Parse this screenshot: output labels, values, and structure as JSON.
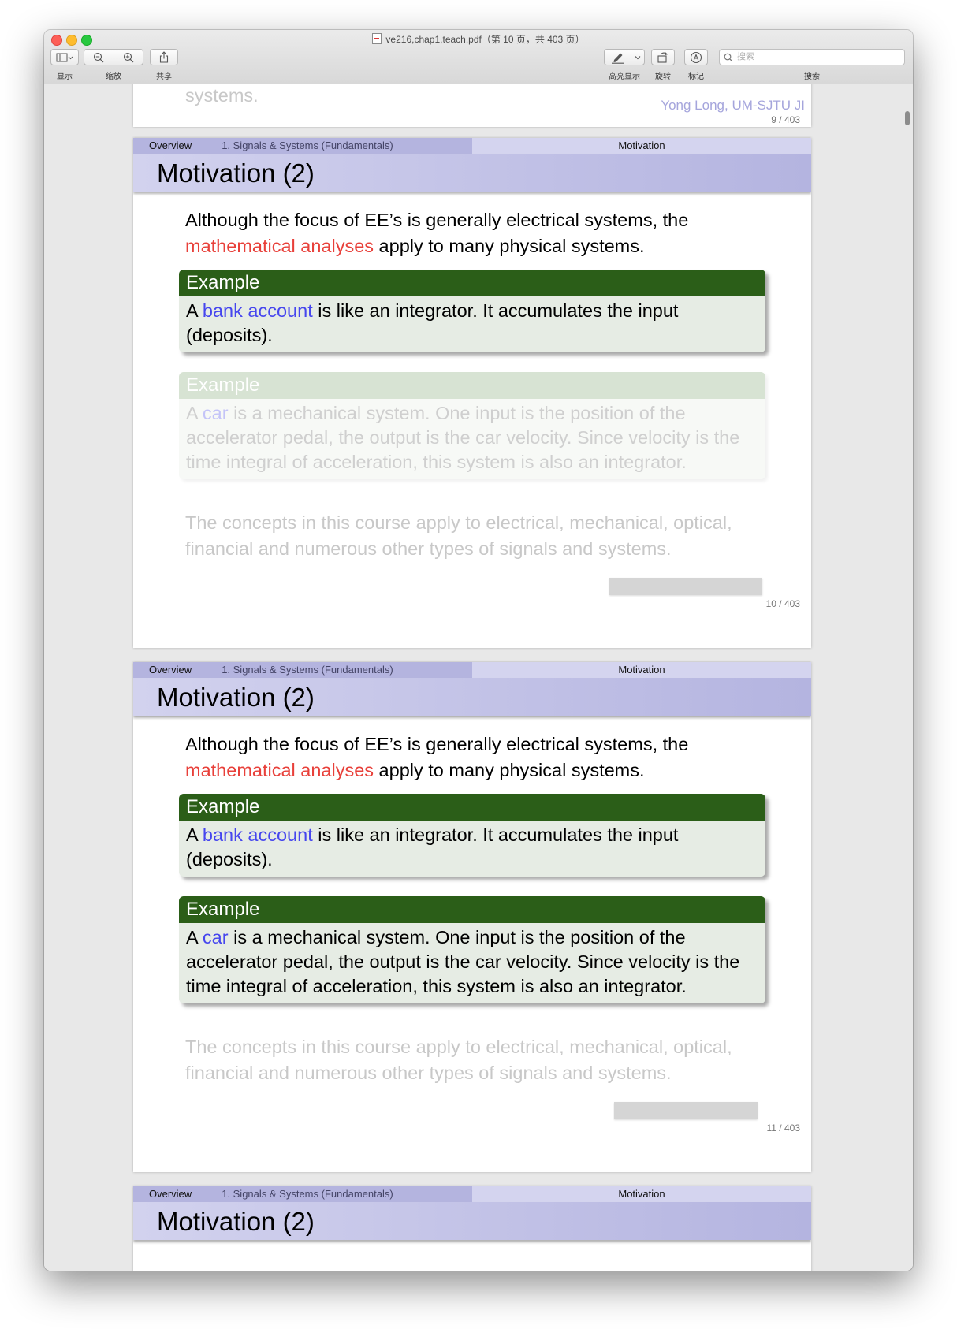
{
  "window": {
    "title": "ve216,chap1,teach.pdf（第 10 页，共 403 页）"
  },
  "toolbar": {
    "display_label": "显示",
    "zoom_label": "缩放",
    "share_label": "共享",
    "highlight_label": "高亮显示",
    "rotate_label": "旋转",
    "markup_label": "标记",
    "search_label": "搜索",
    "search_placeholder": "搜索"
  },
  "pages": {
    "p9": {
      "page_number": "9 / 403",
      "author": "Yong Long, UM-SJTU JI",
      "partial_text": "systems."
    },
    "p10": {
      "nav_section": "Overview",
      "nav_subsection": "1. Signals & Systems (Fundamentals)",
      "nav_right": "Motivation",
      "title": "Motivation (2)",
      "intro_a": "Although the focus of EE’s is generally electrical systems, the ",
      "intro_red": "mathematical analyses",
      "intro_b": " apply to many physical systems.",
      "ex1_title": "Example",
      "ex1_a": "A ",
      "ex1_blue": "bank account",
      "ex1_b": " is like an integrator. It accumulates the input (deposits).",
      "ex2_title": "Example",
      "ex2_a": "A ",
      "ex2_blue": "car",
      "ex2_b": " is a mechanical system. One input is the position of the accelerator pedal, the output is the car velocity. Since velocity is the time integral of acceleration, this system is also an integrator.",
      "closing": "The concepts in this course apply to electrical, mechanical, optical, financial and numerous other types of signals and systems.",
      "page_number": "10 / 403"
    },
    "p11": {
      "nav_section": "Overview",
      "nav_subsection": "1. Signals & Systems (Fundamentals)",
      "nav_right": "Motivation",
      "title": "Motivation (2)",
      "intro_a": "Although the focus of EE’s is generally electrical systems, the ",
      "intro_red": "mathematical analyses",
      "intro_b": " apply to many physical systems.",
      "ex1_title": "Example",
      "ex1_a": "A ",
      "ex1_blue": "bank account",
      "ex1_b": " is like an integrator. It accumulates the input (deposits).",
      "ex2_title": "Example",
      "ex2_a": "A ",
      "ex2_blue": "car",
      "ex2_b": " is a mechanical system. One input is the position of the accelerator pedal, the output is the car velocity. Since velocity is the time integral of acceleration, this system is also an integrator.",
      "closing": "The concepts in this course apply to electrical, mechanical, optical, financial and numerous other types of signals and systems.",
      "page_number": "11 / 403"
    },
    "p12": {
      "nav_section": "Overview",
      "nav_subsection": "1. Signals & Systems (Fundamentals)",
      "nav_right": "Motivation",
      "title": "Motivation (2)"
    }
  },
  "colors": {
    "nav_dark": "#b4b4df",
    "nav_light": "#d4d4ef",
    "block_header": "#2b5e18",
    "block_body": "#e6ece4",
    "alert_red": "#e8403a",
    "structure_blue": "#4646ee"
  },
  "icons": [
    "sidebar-icon",
    "zoom-out-icon",
    "zoom-in-icon",
    "share-icon",
    "pen-icon",
    "chevron-down-icon",
    "rotate-icon",
    "markup-icon",
    "search-icon",
    "pdf-file-icon"
  ]
}
